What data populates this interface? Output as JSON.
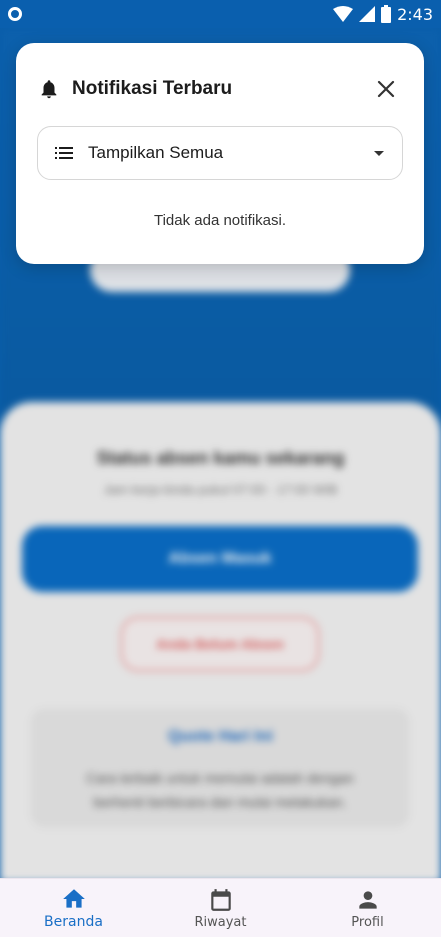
{
  "status_bar": {
    "time": "2:43"
  },
  "background": {
    "status_title": "Status absen kamu sekarang",
    "status_subtitle": "Jam kerja kinda pukul 07:00 - 17:00 WIB",
    "primary_button": "Absen Masuk",
    "secondary_button": "Anda Belum Absen",
    "quote_title": "Quote Hari Ini",
    "quote_text": "Cara terbaik untuk memulai adalah dengan berhenti berbicara dan mulai melakukan."
  },
  "notification_panel": {
    "title": "Notifikasi Terbaru",
    "filter": {
      "selected": "Tampilkan Semua"
    },
    "empty_message": "Tidak ada notifikasi.",
    "icons": {
      "header": "bell-icon",
      "close": "close-icon",
      "filter": "list-icon",
      "dropdown": "caret-down-icon"
    }
  },
  "bottom_nav": {
    "items": [
      {
        "label": "Beranda",
        "icon": "home-icon",
        "active": true
      },
      {
        "label": "Riwayat",
        "icon": "calendar-icon",
        "active": false
      },
      {
        "label": "Profil",
        "icon": "person-icon",
        "active": false
      }
    ]
  },
  "colors": {
    "primary": "#0a63b4",
    "active_nav": "#1a6fc6",
    "card_bg": "#ffffff"
  }
}
